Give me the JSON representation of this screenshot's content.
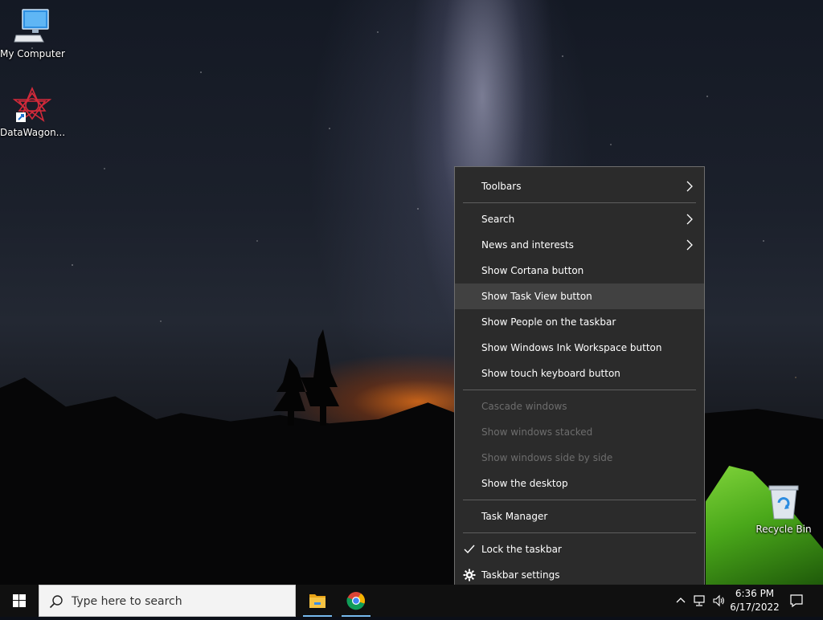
{
  "desktop": {
    "icons": [
      {
        "label": "My Computer",
        "icon": "monitor-icon"
      },
      {
        "label": "DataWagon...",
        "icon": "datawagon-app-icon"
      },
      {
        "label": "Recycle Bin",
        "icon": "recycle-bin-icon"
      }
    ]
  },
  "context_menu": {
    "items": [
      {
        "label": "Toolbars",
        "submenu": true
      },
      {
        "label": "Search",
        "submenu": true
      },
      {
        "label": "News and interests",
        "submenu": true
      },
      {
        "label": "Show Cortana button"
      },
      {
        "label": "Show Task View button",
        "highlighted": true
      },
      {
        "label": "Show People on the taskbar"
      },
      {
        "label": "Show Windows Ink Workspace button"
      },
      {
        "label": "Show touch keyboard button"
      },
      {
        "label": "Cascade windows",
        "disabled": true
      },
      {
        "label": "Show windows stacked",
        "disabled": true
      },
      {
        "label": "Show windows side by side",
        "disabled": true
      },
      {
        "label": "Show the desktop"
      },
      {
        "label": "Task Manager"
      },
      {
        "label": "Lock the taskbar",
        "checked": true
      },
      {
        "label": "Taskbar settings",
        "icon": "gear-icon"
      }
    ]
  },
  "taskbar": {
    "search_placeholder": "Type here to search",
    "pinned": [
      "file-explorer-icon",
      "chrome-icon"
    ],
    "tray": [
      "chevron-up-icon",
      "network-icon",
      "volume-icon"
    ],
    "time": "6:36 PM",
    "date": "6/17/2022"
  },
  "colors": {
    "menu_bg": "#2b2b2b",
    "menu_hover": "#414141",
    "disabled_text": "#6d6d6d",
    "taskbar_bg": "#101010"
  }
}
